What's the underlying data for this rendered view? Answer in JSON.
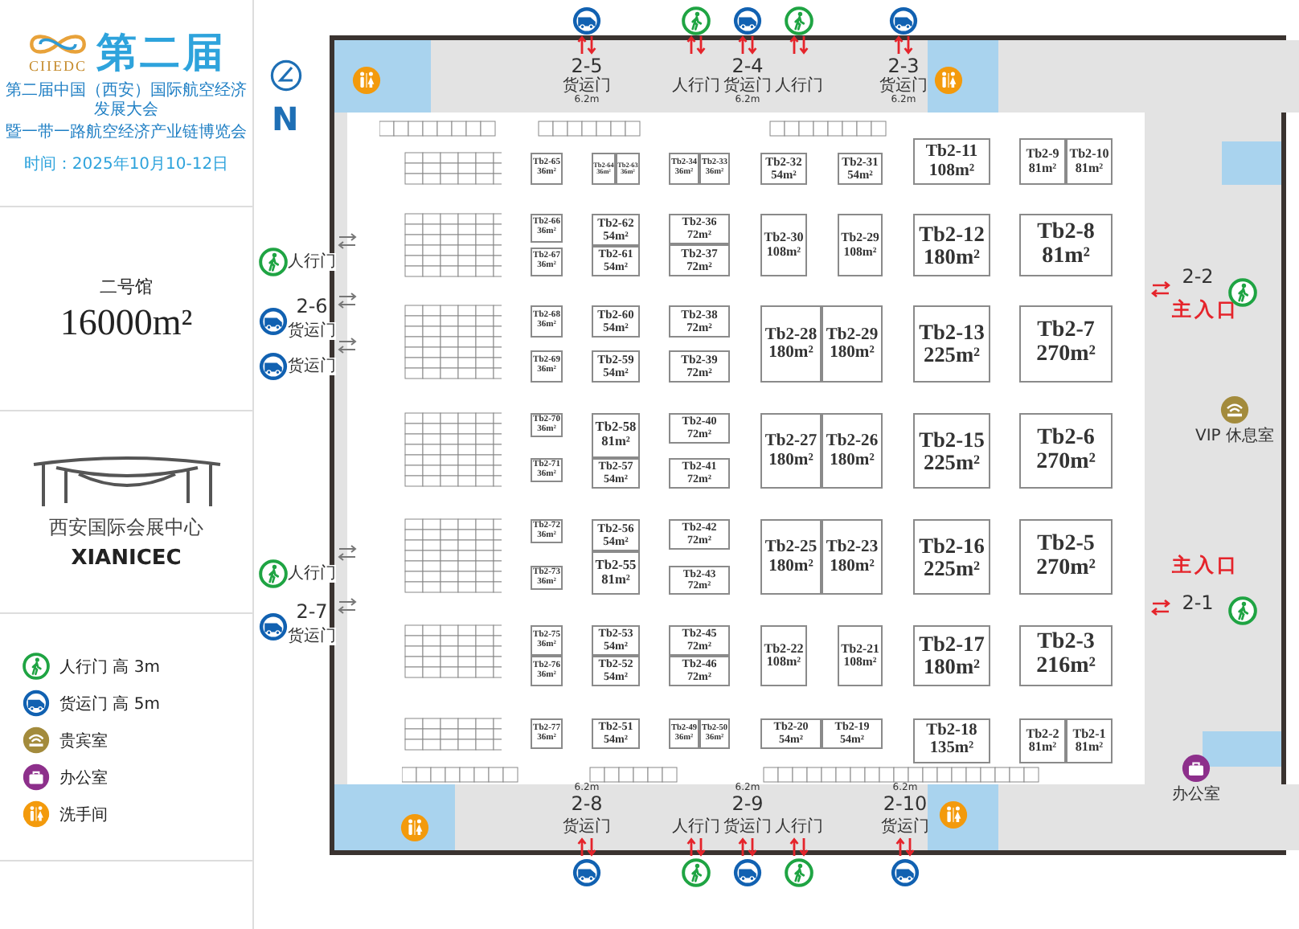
{
  "event": {
    "logo_text": "CIIEDC",
    "edition": "第二届",
    "subtitle": [
      "第二届中国（西安）国际航空经济发展大会",
      "暨一带一路航空经济产业链博览会"
    ],
    "date": "时间：2025年10月10-12日"
  },
  "hall": {
    "name": "二号馆",
    "area": "16000m²"
  },
  "venue": {
    "name": "西安国际会展中心",
    "name_en": "XIANICEC"
  },
  "legend": [
    {
      "kind": "pedestrian",
      "label": "人行门 高 3m"
    },
    {
      "kind": "cargo",
      "label": "货运门 高 5m"
    },
    {
      "kind": "vip",
      "label": "贵宾室"
    },
    {
      "kind": "office",
      "label": "办公室"
    },
    {
      "kind": "restroom",
      "label": "洗手间"
    }
  ],
  "compass": {
    "label": "N"
  },
  "gates": [
    {
      "kind": "top",
      "code": "2-5",
      "width": "6.2m",
      "doors": [
        {
          "kind": "cargo",
          "label": "货运门"
        }
      ]
    },
    {
      "kind": "top",
      "code": "2-4",
      "width": "6.2m",
      "doors": [
        {
          "kind": "pedestrian",
          "label": "人行门"
        },
        {
          "kind": "cargo",
          "label": "货运门"
        },
        {
          "kind": "pedestrian",
          "label": "人行门"
        }
      ]
    },
    {
      "kind": "top",
      "code": "2-3",
      "width": "6.2m",
      "doors": [
        {
          "kind": "cargo",
          "label": "货运门"
        }
      ]
    },
    {
      "kind": "left",
      "doors": [
        {
          "kind": "pedestrian",
          "label": "人行门"
        }
      ]
    },
    {
      "kind": "left",
      "code": "2-6",
      "doors": [
        {
          "kind": "cargo",
          "label": "货运门"
        }
      ]
    },
    {
      "kind": "left",
      "doors": [
        {
          "kind": "cargo",
          "label": "货运门"
        }
      ]
    },
    {
      "kind": "left",
      "doors": [
        {
          "kind": "pedestrian",
          "label": "人行门"
        }
      ]
    },
    {
      "kind": "left",
      "code": "2-7",
      "doors": [
        {
          "kind": "cargo",
          "label": "货运门"
        }
      ]
    },
    {
      "kind": "bottom",
      "code": "2-8",
      "width": "6.2m",
      "doors": [
        {
          "kind": "cargo",
          "label": "货运门"
        }
      ]
    },
    {
      "kind": "bottom",
      "code": "2-9",
      "width": "6.2m",
      "doors": [
        {
          "kind": "pedestrian",
          "label": "人行门"
        },
        {
          "kind": "cargo",
          "label": "货运门"
        },
        {
          "kind": "pedestrian",
          "label": "人行门"
        }
      ]
    },
    {
      "kind": "bottom",
      "code": "2-10",
      "width": "6.2m",
      "doors": [
        {
          "kind": "cargo",
          "label": "货运门"
        }
      ]
    }
  ],
  "entrances": [
    {
      "code": "2-2",
      "label": "主入口"
    },
    {
      "code": "2-1",
      "label": "主入口"
    }
  ],
  "rooms": [
    {
      "kind": "vip",
      "label": "VIP 休息室"
    },
    {
      "kind": "office",
      "label": "办公室"
    }
  ],
  "booths": [
    {
      "name": "Tb2-65",
      "area": "36m²"
    },
    {
      "name": "Tb2-64",
      "area": "36m²"
    },
    {
      "name": "Tb2-63",
      "area": "36m²"
    },
    {
      "name": "Tb2-34",
      "area": "36m²"
    },
    {
      "name": "Tb2-33",
      "area": "36m²"
    },
    {
      "name": "Tb2-32",
      "area": "54m²"
    },
    {
      "name": "Tb2-31",
      "area": "54m²"
    },
    {
      "name": "Tb2-11",
      "area": "108m²"
    },
    {
      "name": "Tb2-9",
      "area": "81m²"
    },
    {
      "name": "Tb2-10",
      "area": "81m²"
    },
    {
      "name": "Tb2-66",
      "area": "36m²"
    },
    {
      "name": "Tb2-67",
      "area": "36m²"
    },
    {
      "name": "Tb2-62",
      "area": "54m²"
    },
    {
      "name": "Tb2-61",
      "area": "54m²"
    },
    {
      "name": "Tb2-36",
      "area": "72m²"
    },
    {
      "name": "Tb2-37",
      "area": "72m²"
    },
    {
      "name": "Tb2-30",
      "area": "108m²"
    },
    {
      "name": "Tb2-29",
      "area": "108m²"
    },
    {
      "name": "Tb2-12",
      "area": "180m²"
    },
    {
      "name": "Tb2-8",
      "area": "81m²"
    },
    {
      "name": "Tb2-68",
      "area": "36m²"
    },
    {
      "name": "Tb2-69",
      "area": "36m²"
    },
    {
      "name": "Tb2-60",
      "area": "54m²"
    },
    {
      "name": "Tb2-59",
      "area": "54m²"
    },
    {
      "name": "Tb2-38",
      "area": "72m²"
    },
    {
      "name": "Tb2-39",
      "area": "72m²"
    },
    {
      "name": "Tb2-28",
      "area": "180m²"
    },
    {
      "name": "Tb2-29",
      "area": "180m²"
    },
    {
      "name": "Tb2-13",
      "area": "225m²"
    },
    {
      "name": "Tb2-7",
      "area": "270m²"
    },
    {
      "name": "Tb2-70",
      "area": "36m²"
    },
    {
      "name": "Tb2-71",
      "area": "36m²"
    },
    {
      "name": "Tb2-58",
      "area": "81m²"
    },
    {
      "name": "Tb2-57",
      "area": "54m²"
    },
    {
      "name": "Tb2-40",
      "area": "72m²"
    },
    {
      "name": "Tb2-41",
      "area": "72m²"
    },
    {
      "name": "Tb2-27",
      "area": "180m²"
    },
    {
      "name": "Tb2-26",
      "area": "180m²"
    },
    {
      "name": "Tb2-15",
      "area": "225m²"
    },
    {
      "name": "Tb2-6",
      "area": "270m²"
    },
    {
      "name": "Tb2-72",
      "area": "36m²"
    },
    {
      "name": "Tb2-73",
      "area": "36m²"
    },
    {
      "name": "Tb2-56",
      "area": "54m²"
    },
    {
      "name": "Tb2-55",
      "area": "81m²"
    },
    {
      "name": "Tb2-42",
      "area": "72m²"
    },
    {
      "name": "Tb2-43",
      "area": "72m²"
    },
    {
      "name": "Tb2-25",
      "area": "180m²"
    },
    {
      "name": "Tb2-23",
      "area": "180m²"
    },
    {
      "name": "Tb2-16",
      "area": "225m²"
    },
    {
      "name": "Tb2-5",
      "area": "270m²"
    },
    {
      "name": "Tb2-75",
      "area": "36m²"
    },
    {
      "name": "Tb2-76",
      "area": "36m²"
    },
    {
      "name": "Tb2-53",
      "area": "54m²"
    },
    {
      "name": "Tb2-52",
      "area": "54m²"
    },
    {
      "name": "Tb2-45",
      "area": "72m²"
    },
    {
      "name": "Tb2-46",
      "area": "72m²"
    },
    {
      "name": "Tb2-22",
      "area": "108m²"
    },
    {
      "name": "Tb2-21",
      "area": "108m²"
    },
    {
      "name": "Tb2-17",
      "area": "180m²"
    },
    {
      "name": "Tb2-3",
      "area": "216m²"
    },
    {
      "name": "Tb2-77",
      "area": "36m²"
    },
    {
      "name": "Tb2-51",
      "area": "54m²"
    },
    {
      "name": "Tb2-49",
      "area": "36m²"
    },
    {
      "name": "Tb2-50",
      "area": "36m²"
    },
    {
      "name": "Tb2-20",
      "area": "54m²"
    },
    {
      "name": "Tb2-19",
      "area": "54m²"
    },
    {
      "name": "Tb2-18",
      "area": "135m²"
    },
    {
      "name": "Tb2-2",
      "area": "81m²"
    },
    {
      "name": "Tb2-1",
      "area": "81m²"
    }
  ]
}
